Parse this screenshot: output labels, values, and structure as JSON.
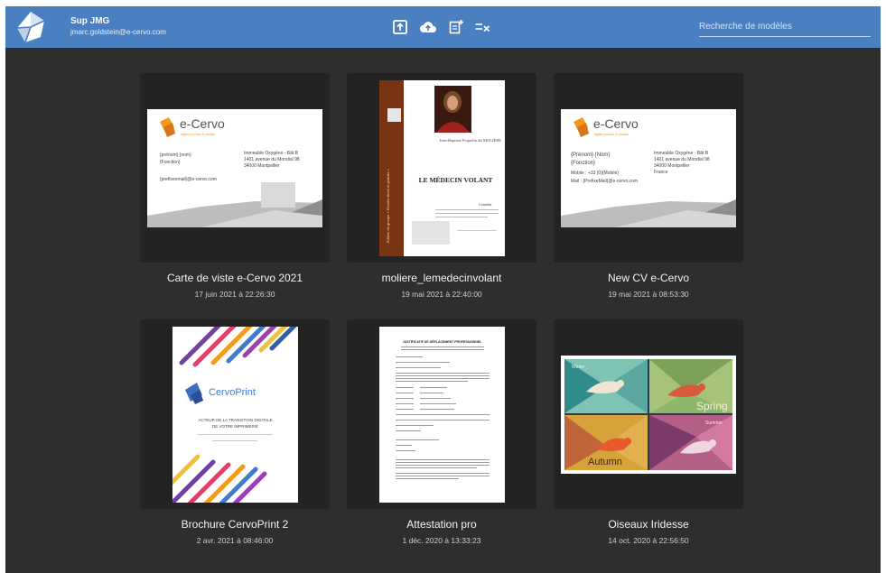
{
  "header": {
    "user_name": "Sup JMG",
    "user_email": "jmarc.goldstein@e-cervo.com",
    "search_placeholder": "Recherche de modèles",
    "toolbar_icons": [
      "import-icon",
      "cloud-upload-icon",
      "new-document-icon",
      "checklist-clear-icon"
    ]
  },
  "colors": {
    "header": "#4a7fc1",
    "background": "#2e2e2e",
    "card": "#232323",
    "accent_orange": "#f39a1e"
  },
  "templates": [
    {
      "title": "Carte de viste e-Cervo 2021",
      "date": "17 juin 2021 à 22:26:30",
      "preview": {
        "brand": "e-Cervo",
        "tagline": "digital process & medias",
        "left_lines": [
          "{prénom} {nom}",
          "{Fonction}",
          "",
          "{prefixeemail}@e-cervo.com"
        ],
        "right_lines": [
          "Immeuble Oxygène - Bât B",
          "1401 avenue du Mondial 98",
          "34000 Montpellier"
        ]
      }
    },
    {
      "title": "moliere_lemedecinvolant",
      "date": "19 mai 2021 à 22:40:00",
      "preview": {
        "author": "Jean-Baptiste Poquelin dit MOLIÈRE",
        "play": "LE MÉDECIN VOLANT",
        "genre": "Comédie",
        "spine": "Édition du groupe « Ebooks libres et gratuits »"
      }
    },
    {
      "title": "New CV e-Cervo",
      "date": "19 mai 2021 à 08:53:30",
      "preview": {
        "brand": "e-Cervo",
        "tagline": "digital process & medias",
        "left_lines": [
          "{Prénom} {Nom}",
          "{Fonction}",
          "Mobile : +33 (0){Mobile}",
          "Mail : {PrefixeMail}@e-cervo.com"
        ],
        "right_lines": [
          "Immeuble Oxygène - Bât B",
          "1401 avenue du Mondial 98",
          "34000 Montpellier",
          "France"
        ]
      }
    },
    {
      "title": "Brochure CervoPrint 2",
      "date": "2 avr. 2021 à 08:46:00",
      "preview": {
        "brand": "CervoPrint",
        "line1": "ACTEUR DE LA TRANSITION DIGITALE",
        "line2": "DE VOTRE IMPRIMERIE"
      }
    },
    {
      "title": "Attestation pro",
      "date": "1 déc. 2020 à 13:33:23",
      "preview": {
        "heading": "JUSTIFICATIF DE DÉPLACEMENT PROFESSIONNEL"
      }
    },
    {
      "title": "Oiseaux Iridesse",
      "date": "14 oct. 2020 à 22:56:50",
      "preview": {
        "words": [
          "Spring",
          "Autumn",
          "Winter",
          "Summer"
        ]
      }
    }
  ]
}
